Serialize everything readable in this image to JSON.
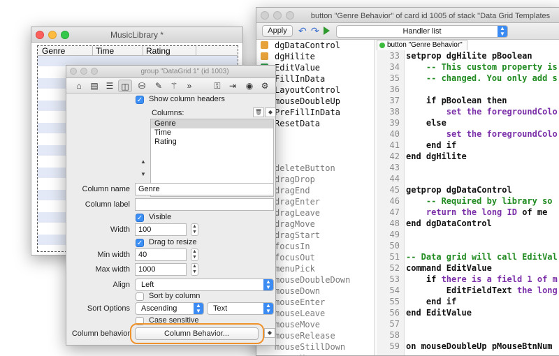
{
  "script_editor": {
    "title": "button \"Genre Behavior\" of card id 1005 of stack \"Data Grid Templates",
    "apply_label": "Apply",
    "handler_list_label": "Handler list",
    "tab_label": "button \"Genre Behavior\"",
    "handlers": [
      {
        "name": "dgDataControl",
        "icon": "property-icon",
        "muted": false
      },
      {
        "name": "dgHilite",
        "icon": "property-icon",
        "muted": false
      },
      {
        "name": "EditValue",
        "icon": "command-icon",
        "muted": false
      },
      {
        "name": "FillInData",
        "icon": "",
        "muted": false
      },
      {
        "name": "LayoutControl",
        "icon": "",
        "muted": false
      },
      {
        "name": "mouseDoubleUp",
        "icon": "",
        "muted": false
      },
      {
        "name": "PreFillInData",
        "icon": "",
        "muted": false
      },
      {
        "name": "ResetData",
        "icon": "",
        "muted": false
      },
      {
        "name": "",
        "icon": "",
        "muted": true
      },
      {
        "name": "",
        "icon": "",
        "muted": true
      },
      {
        "name": "",
        "icon": "",
        "muted": true
      },
      {
        "name": "deleteButton",
        "icon": "",
        "muted": true
      },
      {
        "name": "dragDrop",
        "icon": "",
        "muted": true
      },
      {
        "name": "dragEnd",
        "icon": "",
        "muted": true
      },
      {
        "name": "dragEnter",
        "icon": "",
        "muted": true
      },
      {
        "name": "dragLeave",
        "icon": "",
        "muted": true
      },
      {
        "name": "dragMove",
        "icon": "",
        "muted": true
      },
      {
        "name": "dragStart",
        "icon": "",
        "muted": true
      },
      {
        "name": "focusIn",
        "icon": "",
        "muted": true
      },
      {
        "name": "focusOut",
        "icon": "",
        "muted": true
      },
      {
        "name": "menuPick",
        "icon": "",
        "muted": true
      },
      {
        "name": "mouseDoubleDown",
        "icon": "",
        "muted": true
      },
      {
        "name": "mouseDown",
        "icon": "",
        "muted": true
      },
      {
        "name": "mouseEnter",
        "icon": "",
        "muted": true
      },
      {
        "name": "mouseLeave",
        "icon": "",
        "muted": true
      },
      {
        "name": "mouseMove",
        "icon": "",
        "muted": true
      },
      {
        "name": "mouseRelease",
        "icon": "",
        "muted": true
      },
      {
        "name": "mouseStillDown",
        "icon": "",
        "muted": true
      },
      {
        "name": "mouseUp",
        "icon": "",
        "muted": true
      }
    ],
    "line_numbers": [
      "33",
      "34",
      "35",
      "36",
      "37",
      "38",
      "39",
      "40",
      "41",
      "42",
      "43",
      "44",
      "45",
      "46",
      "47",
      "48",
      "49",
      "50",
      "51",
      "52",
      "53",
      "54",
      "55",
      "56",
      "57",
      "58",
      "59"
    ],
    "code_lines": [
      [
        {
          "t": "setprop dgHilite pBoolean",
          "c": "#111111"
        }
      ],
      [
        {
          "t": "    -- This custom property is",
          "c": "#1f8a1f"
        }
      ],
      [
        {
          "t": "    -- changed. You only add s",
          "c": "#1f8a1f"
        }
      ],
      [
        {
          "t": "",
          "c": "#111111"
        }
      ],
      [
        {
          "t": "    if pBoolean ",
          "c": "#111111"
        },
        {
          "t": "then",
          "c": "#111111"
        }
      ],
      [
        {
          "t": "        set ",
          "c": "#7b2fa8"
        },
        {
          "t": "the ",
          "c": "#7b2fa8"
        },
        {
          "t": "foregroundColo",
          "c": "#7b2fa8"
        }
      ],
      [
        {
          "t": "    else",
          "c": "#111111"
        }
      ],
      [
        {
          "t": "        set ",
          "c": "#7b2fa8"
        },
        {
          "t": "the ",
          "c": "#7b2fa8"
        },
        {
          "t": "foregroundColo",
          "c": "#7b2fa8"
        }
      ],
      [
        {
          "t": "    end if",
          "c": "#111111"
        }
      ],
      [
        {
          "t": "end dgHilite",
          "c": "#111111"
        }
      ],
      [
        {
          "t": "",
          "c": "#111111"
        }
      ],
      [
        {
          "t": "",
          "c": "#111111"
        }
      ],
      [
        {
          "t": "getprop dgDataControl",
          "c": "#111111"
        }
      ],
      [
        {
          "t": "    -- Required by library so",
          "c": "#1f8a1f"
        }
      ],
      [
        {
          "t": "    return ",
          "c": "#7b2fa8"
        },
        {
          "t": "the long ID ",
          "c": "#7b2fa8"
        },
        {
          "t": "of me",
          "c": "#111111"
        }
      ],
      [
        {
          "t": "end dgDataControl",
          "c": "#111111"
        }
      ],
      [
        {
          "t": "",
          "c": "#111111"
        }
      ],
      [
        {
          "t": "",
          "c": "#111111"
        }
      ],
      [
        {
          "t": "-- Data grid will call EditVal",
          "c": "#1f8a1f"
        }
      ],
      [
        {
          "t": "command EditValue",
          "c": "#111111"
        }
      ],
      [
        {
          "t": "    if ",
          "c": "#111111"
        },
        {
          "t": "there is a field 1 of m",
          "c": "#7b2fa8"
        }
      ],
      [
        {
          "t": "        EditFieldText ",
          "c": "#111111"
        },
        {
          "t": "the long",
          "c": "#7b2fa8"
        }
      ],
      [
        {
          "t": "    end if",
          "c": "#111111"
        }
      ],
      [
        {
          "t": "end EditValue",
          "c": "#111111"
        }
      ],
      [
        {
          "t": "",
          "c": "#111111"
        }
      ],
      [
        {
          "t": "",
          "c": "#111111"
        }
      ],
      [
        {
          "t": "on mouseDoubleUp pMouseBtnNum",
          "c": "#111111"
        }
      ]
    ]
  },
  "music_library": {
    "title": "MusicLibrary *",
    "columns": [
      "Genre",
      "Time",
      "Rating"
    ]
  },
  "inspector": {
    "title": "group \"DataGrid 1\" (id 1003)",
    "tools": [
      "house-icon",
      "card-icon",
      "list-icon",
      "columns-icon",
      "database-icon",
      "pencil-icon",
      "wand-icon",
      "chevrons-icon",
      "lock-icon",
      "exit-icon",
      "target-icon",
      "gear-icon"
    ],
    "show_headers_label": "Show column headers",
    "columns_label": "Columns:",
    "column_list": [
      "Genre",
      "Time",
      "Rating"
    ],
    "column_name_label": "Column name",
    "column_name_value": "Genre",
    "column_label_label": "Column label",
    "column_label_value": "",
    "visible_label": "Visible",
    "width_label": "Width",
    "width_value": "100",
    "drag_resize_label": "Drag to resize",
    "min_width_label": "Min width",
    "min_width_value": "40",
    "max_width_label": "Max width",
    "max_width_value": "1000",
    "align_label": "Align",
    "align_value": "Left",
    "sort_by_column_label": "Sort by column",
    "sort_options_label": "Sort Options",
    "sort_order_value": "Ascending",
    "sort_type_value": "Text",
    "case_sensitive_label": "Case sensitive",
    "column_behavior_label": "Column behavior",
    "column_behavior_button": "Column Behavior..."
  },
  "colors": {
    "highlight_ring": "#f0922b",
    "accent_blue": "#3b8bf3"
  }
}
